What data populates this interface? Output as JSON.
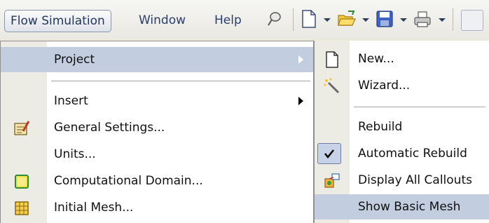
{
  "menubar": {
    "items": [
      {
        "label": "Flow Simulation",
        "active": true
      },
      {
        "label": "Window",
        "active": false
      },
      {
        "label": "Help",
        "active": false
      }
    ],
    "toolbar": [
      "pushpin-icon",
      "new-document-icon",
      "open-folder-icon",
      "save-icon",
      "print-icon"
    ]
  },
  "flow_menu": {
    "items": [
      {
        "label": "Project",
        "has_submenu": true,
        "highlighted": true
      },
      {
        "label": "Insert",
        "has_submenu": true,
        "icon": ""
      },
      {
        "label": "General Settings...",
        "icon": "general-settings-icon"
      },
      {
        "label": "Units...",
        "icon": ""
      },
      {
        "label": "Computational Domain...",
        "icon": "computational-domain-icon"
      },
      {
        "label": "Initial Mesh...",
        "icon": "initial-mesh-icon"
      }
    ]
  },
  "project_submenu": {
    "items": [
      {
        "label": "New...",
        "icon": "new-document-icon"
      },
      {
        "label": "Wizard...",
        "icon": "wizard-wand-icon"
      },
      {
        "label": "Rebuild",
        "icon": ""
      },
      {
        "label": "Automatic Rebuild",
        "icon": "checkmark-icon",
        "checked": true
      },
      {
        "label": "Display All Callouts",
        "icon": "callouts-icon"
      },
      {
        "label": "Show Basic Mesh",
        "icon": "",
        "highlighted": true
      }
    ]
  },
  "colors": {
    "highlight": "#c2cde0",
    "gutter": "#ecebe4",
    "menubar_text": "#2a3e6b"
  }
}
